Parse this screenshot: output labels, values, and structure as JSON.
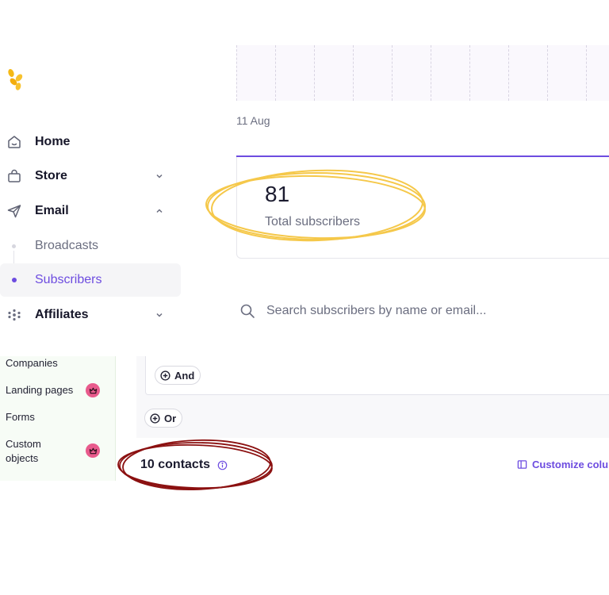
{
  "sidebar": {
    "nav": [
      {
        "label": "Home",
        "icon": "home-icon"
      },
      {
        "label": "Store",
        "icon": "shopping-bag-icon",
        "chevron": "chevron-down-icon"
      },
      {
        "label": "Email",
        "icon": "send-icon",
        "chevron": "chevron-up-icon"
      },
      {
        "label": "Affiliates",
        "icon": "dots-cluster-icon",
        "chevron": "chevron-down-icon"
      }
    ],
    "email_sub": [
      {
        "label": "Broadcasts"
      },
      {
        "label": "Subscribers",
        "active": true
      }
    ]
  },
  "chart": {
    "date_label": "11 Aug"
  },
  "stats": {
    "total_value": "81",
    "total_label": "Total subscribers"
  },
  "search": {
    "placeholder": "Search subscribers by name or email..."
  },
  "secondary_sidebar": {
    "items": [
      {
        "label": "Companies"
      },
      {
        "label": "Landing pages",
        "badge": "crown-icon"
      },
      {
        "label": "Forms"
      },
      {
        "label": "Custom objects",
        "badge": "crown-icon"
      }
    ]
  },
  "filters": {
    "and_label": "And",
    "or_label": "Or"
  },
  "contacts": {
    "count_label": "10 contacts",
    "customize_label": "Customize colum"
  },
  "colors": {
    "accent": "#6d4ce0",
    "highlight_yellow": "#f5c84a",
    "highlight_red": "#8b1010",
    "badge_pink": "#e85a8c"
  }
}
